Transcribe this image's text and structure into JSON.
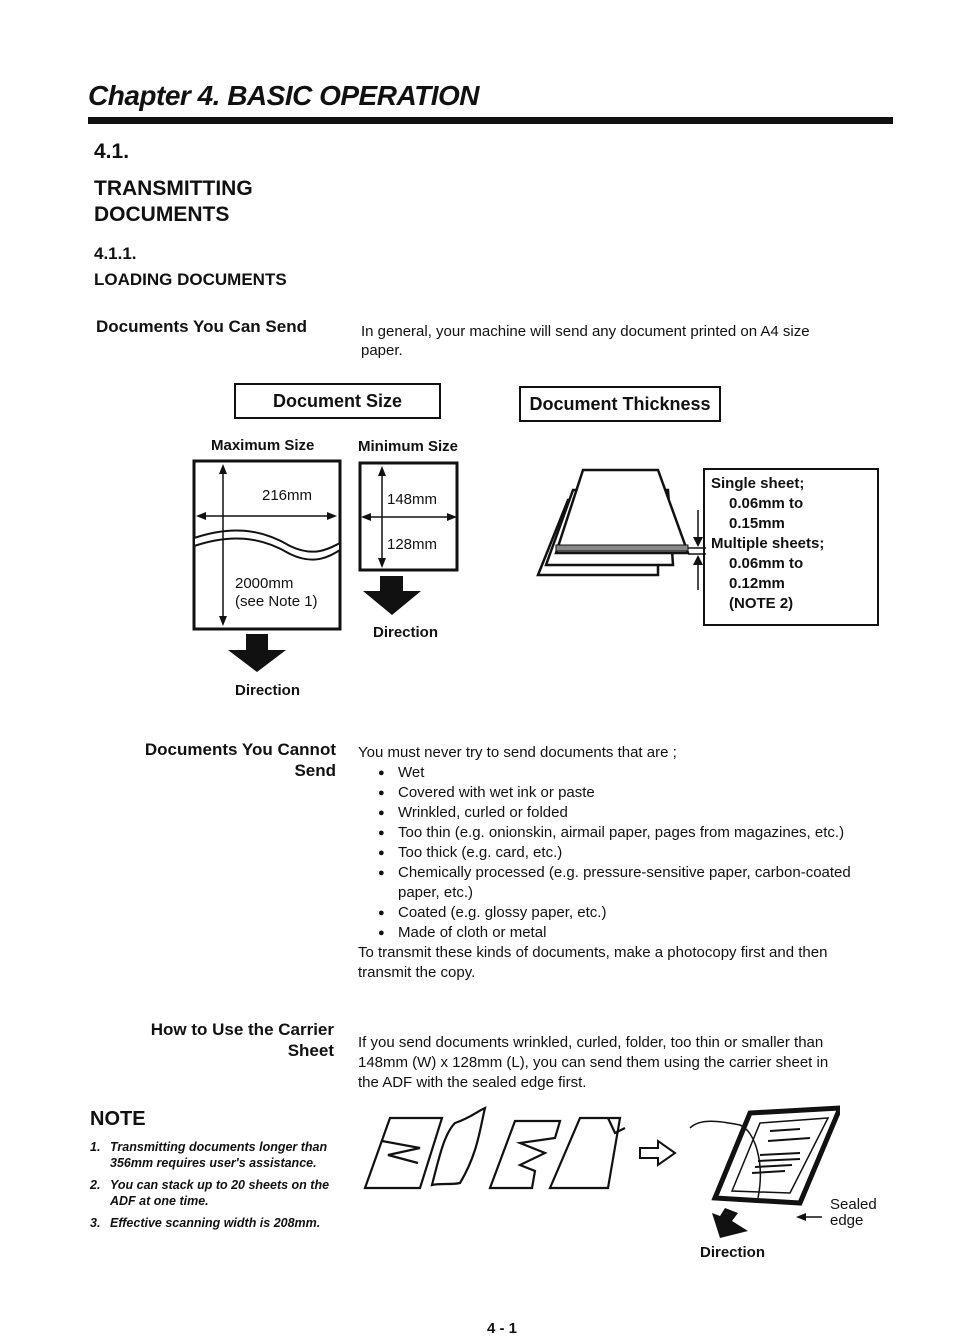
{
  "chapter": {
    "title": "Chapter 4. BASIC OPERATION"
  },
  "section": {
    "number": "4.1.",
    "title_line1": "TRANSMITTING",
    "title_line2": "DOCUMENTS"
  },
  "subsection": {
    "number": "4.1.1.",
    "title": "LOADING DOCUMENTS"
  },
  "can_send": {
    "heading": "Documents You Can Send",
    "text_line1": "In general, your machine will send any document printed on A4 size",
    "text_line2": "paper."
  },
  "doc_size": {
    "title": "Document Size",
    "max_label": "Maximum Size",
    "min_label": "Minimum Size",
    "max_width": "216mm",
    "max_length_line1": "2000mm",
    "max_length_line2": "(see Note 1)",
    "min_width": "148mm",
    "min_length": "128mm",
    "direction_label": "Direction"
  },
  "doc_thickness": {
    "title": "Document Thickness",
    "single_label": "Single sheet;",
    "single_range_line1": "0.06mm to",
    "single_range_line2": "0.15mm",
    "multiple_label": "Multiple sheets;",
    "multiple_range_line1": "0.06mm to",
    "multiple_range_line2": "0.12mm",
    "multiple_note": "(NOTE 2)"
  },
  "cannot_send": {
    "heading_line1": "Documents You Cannot",
    "heading_line2": "Send",
    "intro": "You must never try to send documents that are ;",
    "items": [
      "Wet",
      "Covered with wet ink or paste",
      "Wrinkled, curled or folded",
      "Too thin (e.g. onionskin, airmail paper, pages from magazines, etc.)",
      "Too thick (e.g. card, etc.)",
      "Chemically processed (e.g. pressure-sensitive paper, carbon-coated paper, etc.)",
      "Coated (e.g. glossy paper, etc.)",
      "Made of cloth or metal"
    ],
    "outro": "To transmit these kinds of documents, make a photocopy first and then transmit the copy."
  },
  "carrier": {
    "heading_line1": "How to Use the Carrier",
    "heading_line2": "Sheet",
    "text": "If you send documents wrinkled, curled, folder, too thin or smaller than 148mm (W) x 128mm (L), you can send them using the carrier sheet in the ADF with the sealed edge first.",
    "sealed_line1": "Sealed",
    "sealed_line2": "edge",
    "direction_label": "Direction"
  },
  "note": {
    "title": "NOTE",
    "items": [
      {
        "num": "1.",
        "text": "Transmitting documents longer than 356mm requires user's assistance."
      },
      {
        "num": "2.",
        "text": "You can stack up to 20 sheets on the ADF at one time."
      },
      {
        "num": "3.",
        "text": "Effective scanning width is 208mm."
      }
    ]
  },
  "footer": {
    "page_number": "4 - 1"
  }
}
